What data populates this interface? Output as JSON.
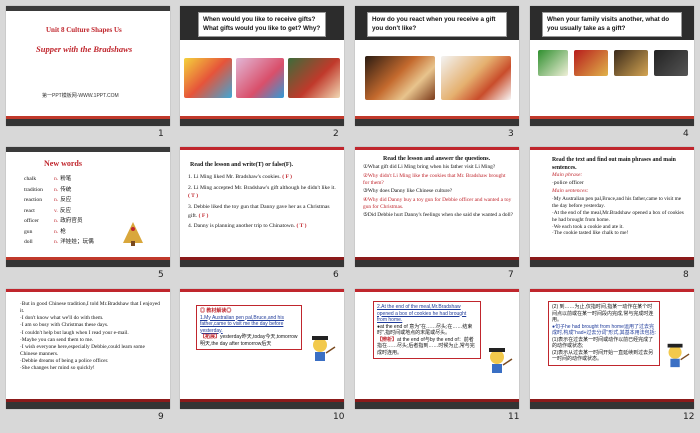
{
  "slides": [
    {
      "num": "1",
      "unit": "Unit 8 Culture Shapes Us",
      "title": "Supper with the Bradshaws",
      "site": "第一PPT模板网-WWW.1PPT.COM"
    },
    {
      "num": "2",
      "question": "When would you like to receive gifts? What gifts would you like to get? Why?"
    },
    {
      "num": "3",
      "question": "How do you react when you receive a gift you don't like?"
    },
    {
      "num": "4",
      "question": "When your family visits another, what do you usually take as a gift?"
    },
    {
      "num": "5",
      "heading": "New words",
      "words": [
        {
          "en": "chalk",
          "pos": "n.",
          "zh": "粉笔"
        },
        {
          "en": "tradition",
          "pos": "n.",
          "zh": "传统"
        },
        {
          "en": "reaction",
          "pos": "n.",
          "zh": "反应"
        },
        {
          "en": "react",
          "pos": "v.",
          "zh": "反应"
        },
        {
          "en": "officer",
          "pos": "n.",
          "zh": "政府官员"
        },
        {
          "en": "gun",
          "pos": "n.",
          "zh": "枪"
        },
        {
          "en": "doll",
          "pos": "n.",
          "zh": "洋娃娃；玩偶"
        }
      ]
    },
    {
      "num": "6",
      "heading": "Read the lesson and write(T) or false(F).",
      "items": [
        {
          "text": "1. Li Ming liked Mr. Bradshaw's cookies.",
          "ans": "( F )"
        },
        {
          "text": "2. Li Ming accepted Mr. Bradshaw's gift although he didn't like it.",
          "ans": "( T )"
        },
        {
          "text": "3. Debbie liked the toy gun that Danny gave her as a Christmas gift.",
          "ans": "( F )"
        },
        {
          "text": "4. Danny is planning another trip to Chinatown.",
          "ans": "( T )"
        }
      ]
    },
    {
      "num": "7",
      "heading": "Read the lesson and answer the questions.",
      "lines": [
        "①What gift did Li Ming bring when his father visit Li Ming?",
        "②Why didn't Li Ming like the cookies that Mr. Bradshaw brought for them?",
        "③Why does Danny like Chinese culture?",
        "④Why did Danny buy a toy gun for Debbie officer and wanted a toy gun for Christmas.",
        "⑤Did Debbie hurt Danny's feelings when she said she wanted a doll?"
      ]
    },
    {
      "num": "8",
      "heading": "Read the text and find out main phrases and main sentences.",
      "phrase_label": "Main phrase:",
      "phrase": "·police officer",
      "sent_label": "Main sentences:",
      "sentences": [
        "·My Australian pen pal,Bruce,and his father,came to visit me the day before yesterday.",
        "·At the end of the meal,Mr.Bradshaw opened a box of cookies he had brought from home.",
        "·We each took a cookie and ate it.",
        "·The cookie tasted like chalk to me!"
      ]
    },
    {
      "num": "9",
      "lines": [
        "·But in good Chinese tradition,I told Mr.Bradshaw that I enjoyed it.",
        "·I don't know what we'll do with them.",
        "·I am so busy with Christmas these days.",
        "·I couldn't help but laugh when I read your e-mail.",
        "·Maybe you can send them to me.",
        "·I wish everyone here,especially Debbie,could learn some Chinese manners.",
        "·Debbie dreams of being a police officer.",
        "·She changes her mind so quickly!"
      ]
    },
    {
      "num": "10",
      "label": "◎ 教材解读◎",
      "quote": "1.My Australian pen pal,Bruce,and his father,came to visit me the day before yesterday.",
      "note_tag": "【拓展】",
      "note": "yesterday昨天,today今天,tomorrow明天,the day after tomorrow后天"
    },
    {
      "num": "11",
      "quote": "2.At the end of the meal,Mr.Bradshaw opened a box of cookies he had brought from home.",
      "p1": "●at the end of 意为\"在……尽头;在……结束时\",指时间或地点的末尾或尽头。",
      "tag": "【辨析】",
      "p2": "at the end of与by the end of：前者指在……尽头;后者指到……时候为止,常与完成时连用。"
    },
    {
      "num": "12",
      "p1": "(2) 到……为止,仅指时间,指某一动作在某个时间点以前或在某一时间段内完成,常与完成时连用。",
      "p2": "●句子he had brought from home运用了过去完成时,构成\"had+过去分词\"形式,其基本用法包括:",
      "p3": "(1)表示在过去某一时间或动作以前已经完成了的动作或状态;",
      "p4": "(2)表示从过去某一时间开始一直延续到过去另一时间的动作或状态。"
    }
  ],
  "colors": {
    "accent": "#c0262d",
    "dark": "#2c2c2c",
    "blue": "#1f3b9a",
    "purple": "#7a2c8a"
  }
}
